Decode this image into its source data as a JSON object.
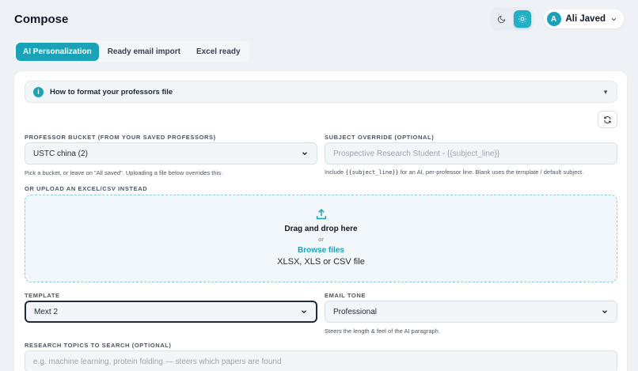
{
  "header": {
    "title": "Compose",
    "theme_icons": [
      "moon-icon",
      "sun-icon"
    ],
    "user": {
      "initial": "A",
      "name": "Ali Javed"
    }
  },
  "tabs": [
    {
      "label": "AI Personalization",
      "active": true
    },
    {
      "label": "Ready email import",
      "active": false
    },
    {
      "label": "Excel ready",
      "active": false
    }
  ],
  "info": {
    "label": "How to format your professors file"
  },
  "professor_bucket": {
    "label": "Professor bucket (from your saved professors)",
    "value": "USTC china (2)",
    "hint": "Pick a bucket, or leave on \"All saved\". Uploading a file below overrides this."
  },
  "subject_override": {
    "label": "Subject override (optional)",
    "placeholder": "Prospective Research Student - {{subject_line}}",
    "hint_pre": "Include ",
    "hint_code": "{{subject_line}}",
    "hint_post": " for an AI, per-professor line. Blank uses the template / default subject."
  },
  "upload": {
    "label": "Or upload an Excel/CSV instead",
    "title": "Drag and drop here",
    "or": "or",
    "browse": "Browse files",
    "formats": "XLSX, XLS or CSV file"
  },
  "template": {
    "label": "Template",
    "value": "Mext 2"
  },
  "email_tone": {
    "label": "Email tone",
    "value": "Professional",
    "hint": "Steers the length & feel of the AI paragraph."
  },
  "research_topics": {
    "label": "Research topics to search (optional)",
    "placeholder": "e.g. machine learning, protein folding — steers which papers are found"
  },
  "colors": {
    "accent": "#1aa3b8",
    "background": "#eef2f6"
  }
}
